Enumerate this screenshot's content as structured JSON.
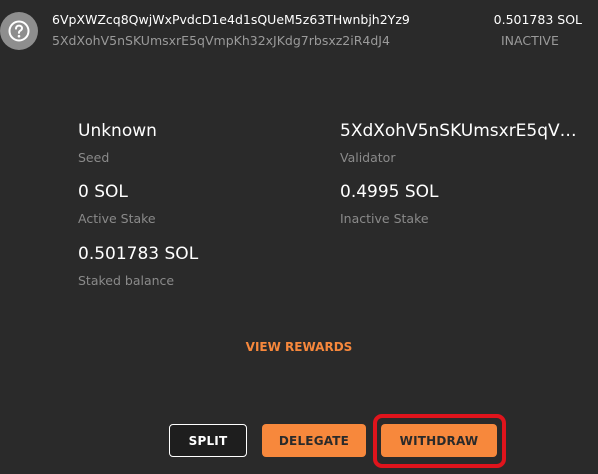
{
  "header": {
    "icon": "question-mark-icon",
    "account_address": "6VpXWZcq8QwjWxPvdcD1e4d1sQUeM5z63THwnbjh2Yz9",
    "validator_address": "5XdXohV5nSKUmsxrE5qVmpKh32xJKdg7rbsxz2iR4dJ4",
    "balance": "0.501783 SOL",
    "status": "INACTIVE"
  },
  "details": {
    "seed": {
      "value": "Unknown",
      "label": "Seed"
    },
    "validator": {
      "value": "5XdXohV5nSKUmsxrE5qVmpKh32xJKdg7rbsxz2iR4dJ4",
      "label": "Validator"
    },
    "active_stake": {
      "value": "0 SOL",
      "label": "Active Stake"
    },
    "inactive_stake": {
      "value": "0.4995 SOL",
      "label": "Inactive Stake"
    },
    "staked_balance": {
      "value": "0.501783 SOL",
      "label": "Staked balance"
    }
  },
  "actions": {
    "view_rewards": "VIEW REWARDS",
    "split": "SPLIT",
    "delegate": "DELEGATE",
    "withdraw": "WITHDRAW"
  },
  "colors": {
    "background": "#2a2a2a",
    "accent": "#f7883c",
    "highlight": "#e0141c"
  }
}
